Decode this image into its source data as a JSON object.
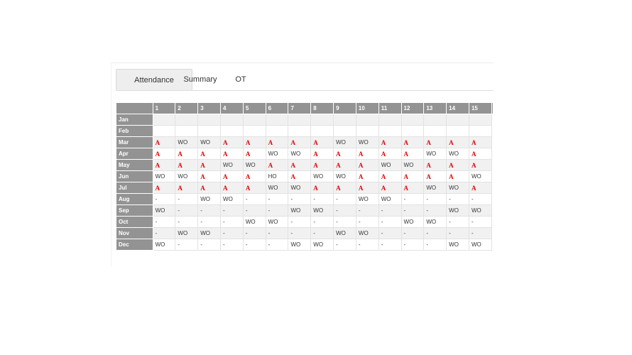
{
  "tabs": [
    {
      "label": "Attendance",
      "active": true
    },
    {
      "label": "Summary",
      "active": false
    },
    {
      "label": "OT",
      "active": false
    }
  ],
  "grid": {
    "days": [
      "1",
      "2",
      "3",
      "4",
      "5",
      "6",
      "7",
      "8",
      "9",
      "10",
      "11",
      "12",
      "13",
      "14",
      "15"
    ],
    "rows": [
      {
        "month": "Jan",
        "cells": [
          "",
          "",
          "",
          "",
          "",
          "",
          "",
          "",
          "",
          "",
          "",
          "",
          "",
          "",
          ""
        ]
      },
      {
        "month": "Feb",
        "cells": [
          "",
          "",
          "",
          "",
          "",
          "",
          "",
          "",
          "",
          "",
          "",
          "",
          "",
          "",
          ""
        ]
      },
      {
        "month": "Mar",
        "cells": [
          "A",
          "WO",
          "WO",
          "A",
          "A",
          "A",
          "A",
          "A",
          "WO",
          "WO",
          "A",
          "A",
          "A",
          "A",
          "A"
        ]
      },
      {
        "month": "Apr",
        "cells": [
          "A",
          "A",
          "A",
          "A",
          "A",
          "WO",
          "WO",
          "A",
          "A",
          "A",
          "A",
          "A",
          "WO",
          "WO",
          "A"
        ]
      },
      {
        "month": "May",
        "cells": [
          "A",
          "A",
          "A",
          "WO",
          "WO",
          "A",
          "A",
          "A",
          "A",
          "A",
          "WO",
          "WO",
          "A",
          "A",
          "A"
        ]
      },
      {
        "month": "Jun",
        "cells": [
          "WO",
          "WO",
          "A",
          "A",
          "A",
          "HO",
          "A",
          "WO",
          "WO",
          "A",
          "A",
          "A",
          "A",
          "A",
          "WO"
        ]
      },
      {
        "month": "Jul",
        "cells": [
          "A",
          "A",
          "A",
          "A",
          "A",
          "WO",
          "WO",
          "A",
          "A",
          "A",
          "A",
          "A",
          "WO",
          "WO",
          "A"
        ]
      },
      {
        "month": "Aug",
        "cells": [
          "-",
          "-",
          "WO",
          "WO",
          "-",
          "-",
          "-",
          "-",
          "-",
          "WO",
          "WO",
          "-",
          "-",
          "-",
          "-"
        ]
      },
      {
        "month": "Sep",
        "cells": [
          "WO",
          "-",
          "-",
          "-",
          "-",
          "-",
          "WO",
          "WO",
          "-",
          "-",
          "-",
          "-",
          "-",
          "WO",
          "WO"
        ]
      },
      {
        "month": "Oct",
        "cells": [
          "-",
          "-",
          "-",
          "-",
          "WO",
          "WO",
          "-",
          "-",
          "-",
          "-",
          "-",
          "WO",
          "WO",
          "-",
          "-"
        ]
      },
      {
        "month": "Nov",
        "cells": [
          "-",
          "WO",
          "WO",
          "-",
          "-",
          "-",
          "-",
          "-",
          "WO",
          "WO",
          "-",
          "-",
          "-",
          "-",
          "-"
        ]
      },
      {
        "month": "Dec",
        "cells": [
          "WO",
          "-",
          "-",
          "-",
          "-",
          "-",
          "WO",
          "WO",
          "-",
          "-",
          "-",
          "-",
          "-",
          "WO",
          "WO"
        ]
      }
    ]
  },
  "colors": {
    "absent": "#e10000",
    "header": "#939393",
    "tab_active": "#eeeeee"
  }
}
